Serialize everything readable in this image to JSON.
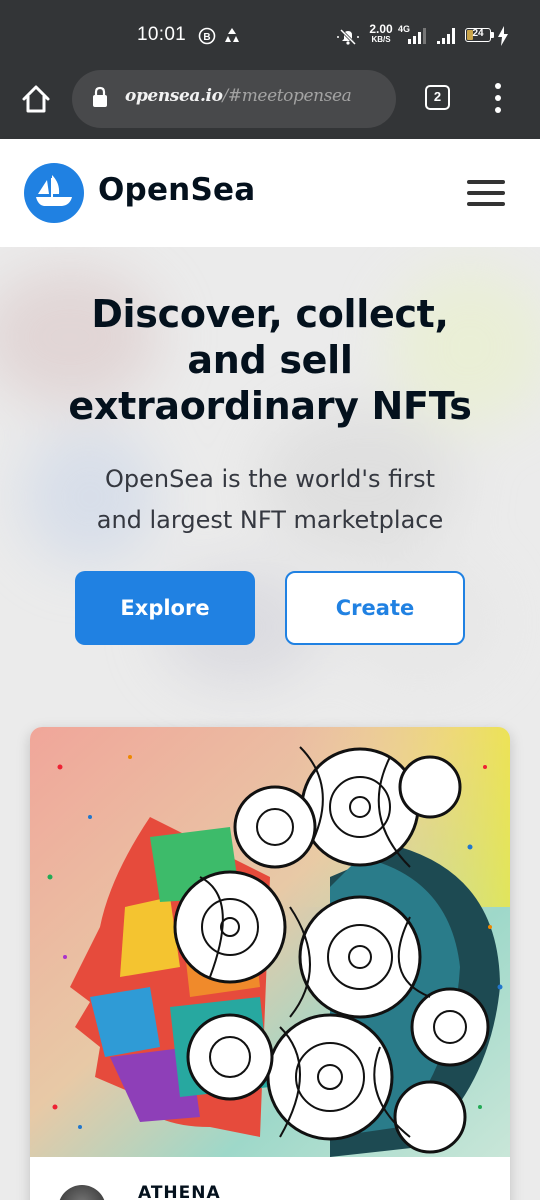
{
  "status_bar": {
    "time": "10:01",
    "net_speed_value": "2.00",
    "net_speed_unit": "KB/S",
    "network_type": "4G",
    "battery_level": "24",
    "icons": [
      "b-badge-icon",
      "recycle-icon",
      "mute-icon",
      "signal-icon",
      "signal-icon",
      "battery-icon",
      "charging-icon"
    ]
  },
  "browser": {
    "url_host": "opensea.io",
    "url_path": "/#meetopensea",
    "tab_count": "2",
    "icons": [
      "home-icon",
      "lock-icon",
      "tabs-icon",
      "more-vert-icon"
    ]
  },
  "site_header": {
    "brand": "OpenSea",
    "icons": [
      "opensea-logo-icon",
      "hamburger-menu-icon"
    ]
  },
  "hero": {
    "headline_line1": "Discover, collect,",
    "headline_line2": "and sell",
    "headline_line3": "extraordinary NFTs",
    "subtitle_line1": "OpenSea is the world's first",
    "subtitle_line2": "and largest NFT marketplace",
    "explore_label": "Explore",
    "create_label": "Create"
  },
  "featured_card": {
    "title": "ATHENA"
  },
  "colors": {
    "status_bar_bg": "#333537",
    "accent_blue": "#2081e2",
    "heading_text": "#04111d",
    "body_text": "#353840"
  }
}
